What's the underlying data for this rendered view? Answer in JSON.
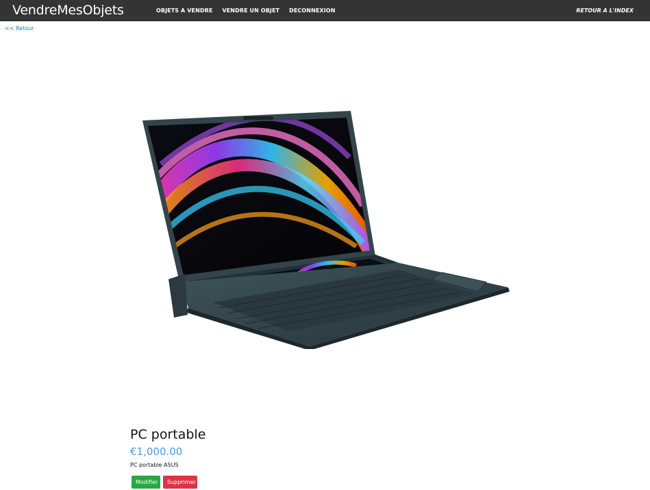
{
  "navbar": {
    "brand": "VendreMesObjets",
    "links": [
      "OBJETS A VENDRE",
      "VENDRE UN OBJET",
      "DECONNEXION"
    ],
    "right_link": "RETOUR A L'INDEX",
    "background": "#343434"
  },
  "back_link": "<< Retour",
  "product": {
    "title": "PC portable",
    "price": "€1,000.00",
    "description": "PC portable ASUS",
    "image_icon": "laptop-image"
  },
  "actions": {
    "modify_label": "Modifier",
    "delete_label": "Supprimer",
    "modify_color": "#28a745",
    "delete_color": "#dc3545"
  }
}
